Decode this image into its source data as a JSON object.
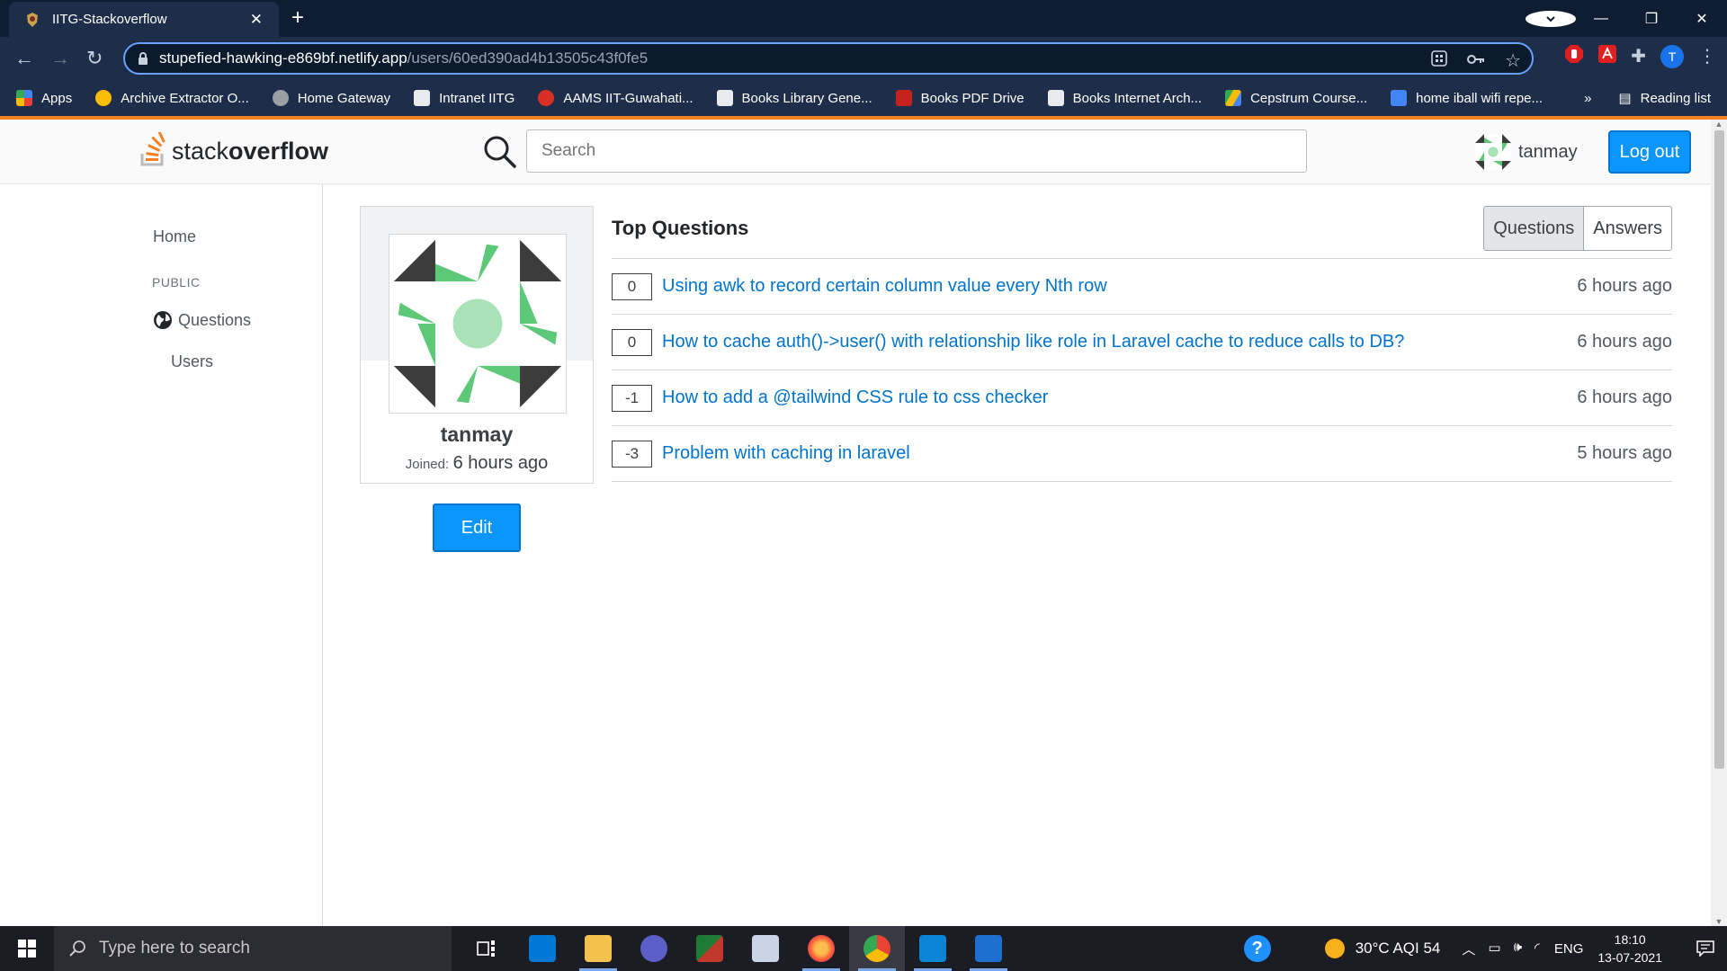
{
  "browser": {
    "tab_title": "IITG-Stackoverflow",
    "new_tab": "+",
    "url_host": "stupefied-hawking-e869bf.netlify.app",
    "url_path": "/users/60ed390ad4b13505c43f0fe5",
    "bookmarks": [
      {
        "label": "Apps",
        "icon": "apps-grid-icon",
        "color": "#4285f4"
      },
      {
        "label": "Archive Extractor O...",
        "icon": "archive-extractor-icon",
        "color": "#fbbc05"
      },
      {
        "label": "Home Gateway",
        "icon": "globe-icon",
        "color": "#9aa0a6"
      },
      {
        "label": "Intranet IITG",
        "icon": "iitg-icon",
        "color": "#e8eaed"
      },
      {
        "label": "AAMS IIT-Guwahati...",
        "icon": "aams-icon",
        "color": "#d93025"
      },
      {
        "label": "Books Library Gene...",
        "icon": "book-icon",
        "color": "#e8eaed"
      },
      {
        "label": "Books PDF Drive",
        "icon": "pdf-drive-icon",
        "color": "#c5221f"
      },
      {
        "label": "Books Internet Arch...",
        "icon": "archive-org-icon",
        "color": "#e8eaed"
      },
      {
        "label": "Cepstrum Course...",
        "icon": "google-drive-icon",
        "color": "#34a853"
      },
      {
        "label": "home iball wifi repe...",
        "icon": "wifi-icon",
        "color": "#4285f4"
      }
    ],
    "bookmarks_overflow": "»",
    "reading_list": "Reading list",
    "profile_initial": "T"
  },
  "header": {
    "logo_prefix": "stack",
    "logo_suffix": "overflow",
    "search_placeholder": "Search",
    "username": "tanmay",
    "logout_label": "Log out"
  },
  "sidebar": {
    "home": "Home",
    "section": "PUBLIC",
    "questions": "Questions",
    "users": "Users"
  },
  "profile": {
    "name": "tanmay",
    "joined_label": "Joined:",
    "joined_value": "6 hours ago",
    "edit_label": "Edit"
  },
  "questions": {
    "title": "Top Questions",
    "tab_questions": "Questions",
    "tab_answers": "Answers",
    "items": [
      {
        "score": "0",
        "title": "Using awk to record certain column value every Nth row",
        "time": "6 hours ago"
      },
      {
        "score": "0",
        "title": "How to cache auth()->user() with relationship like role in Laravel cache to reduce calls to DB?",
        "time": "6 hours ago"
      },
      {
        "score": "-1",
        "title": "How to add a @tailwind CSS rule to css checker",
        "time": "6 hours ago"
      },
      {
        "score": "-3",
        "title": "Problem with caching in laravel",
        "time": "5 hours ago"
      }
    ]
  },
  "taskbar": {
    "search_placeholder": "Type here to search",
    "help": "?",
    "weather": "30°C  AQI 54",
    "language": "ENG",
    "time": "18:10",
    "date": "13-07-2021"
  },
  "colors": {
    "accent": "#0a95ff",
    "link": "#0074cc",
    "brand_orange": "#f48024",
    "identicon_green": "#5cc878",
    "identicon_dark": "#3c3c3c"
  }
}
